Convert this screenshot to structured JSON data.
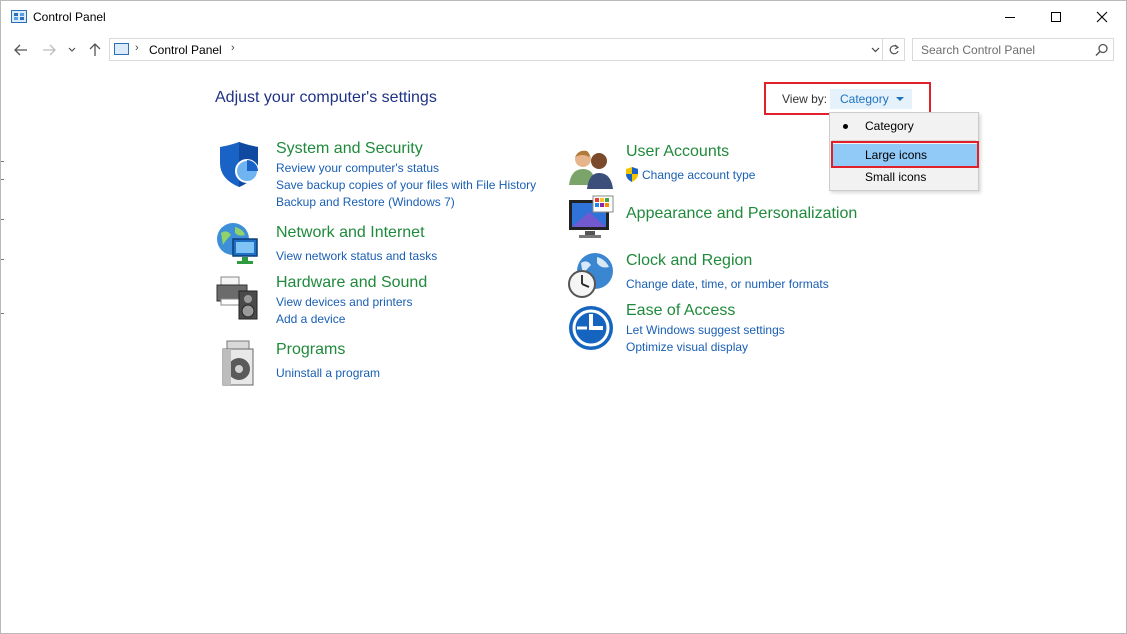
{
  "window": {
    "title": "Control Panel"
  },
  "address_bar": {
    "path": [
      "Control Panel"
    ],
    "search_placeholder": "Search Control Panel"
  },
  "content": {
    "heading": "Adjust your computer's settings",
    "view_by": {
      "label": "View by:",
      "value": "Category",
      "options": [
        {
          "label": "Category",
          "selected": true
        },
        {
          "label": "Large icons",
          "hovered": true
        },
        {
          "label": "Small icons"
        }
      ]
    },
    "left_categories": [
      {
        "title": "System and Security",
        "icon": "shield-icon",
        "links": [
          "Review your computer's status",
          "Save backup copies of your files with File History",
          "Backup and Restore (Windows 7)"
        ]
      },
      {
        "title": "Network and Internet",
        "icon": "network-globe-icon",
        "links": [
          "View network status and tasks"
        ]
      },
      {
        "title": "Hardware and Sound",
        "icon": "printer-speaker-icon",
        "links": [
          "View devices and printers",
          "Add a device"
        ]
      },
      {
        "title": "Programs",
        "icon": "programs-disc-icon",
        "links": [
          "Uninstall a program"
        ]
      }
    ],
    "right_categories": [
      {
        "title": "User Accounts",
        "icon": "users-icon",
        "links": [
          "Change account type"
        ]
      },
      {
        "title": "Appearance and Personalization",
        "icon": "monitor-palette-icon",
        "links": []
      },
      {
        "title": "Clock and Region",
        "icon": "clock-globe-icon",
        "links": [
          "Change date, time, or number formats"
        ]
      },
      {
        "title": "Ease of Access",
        "icon": "ease-of-access-icon",
        "links": [
          "Let Windows suggest settings",
          "Optimize visual display"
        ]
      }
    ]
  },
  "colors": {
    "heading": "#1e3287",
    "category_title": "#1f8a3b",
    "link": "#1a5fb4",
    "highlight_box": "#e0202a",
    "menu_hover": "#91c9f7"
  }
}
